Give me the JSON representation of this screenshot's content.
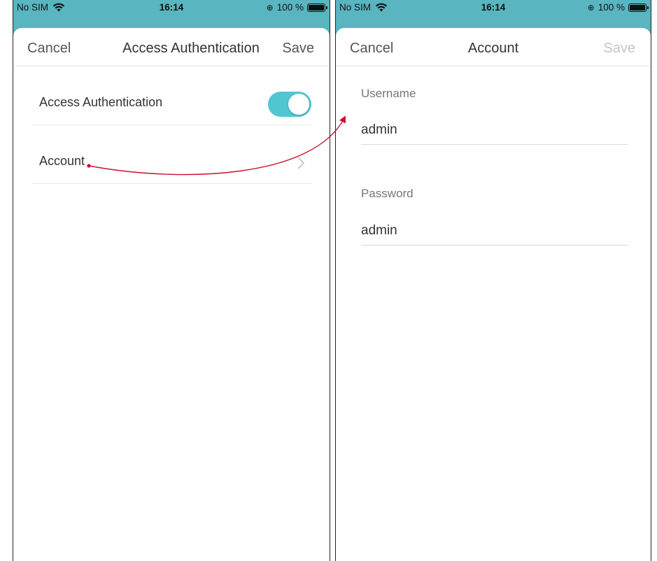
{
  "left_screen": {
    "status_bar": {
      "carrier": "No SIM",
      "time": "16:14",
      "battery": "100 %"
    },
    "nav": {
      "cancel": "Cancel",
      "title": "Access Authentication",
      "save": "Save"
    },
    "rows": [
      {
        "label": "Access Authentication",
        "control": "toggle",
        "toggle_on": true
      },
      {
        "label": "Account",
        "control": "chevron"
      }
    ]
  },
  "right_screen": {
    "status_bar": {
      "carrier": "No SIM",
      "time": "16:14",
      "battery": "100 %"
    },
    "nav": {
      "cancel": "Cancel",
      "title": "Account",
      "save": "Save"
    },
    "fields": [
      {
        "label": "Username",
        "value": "admin"
      },
      {
        "label": "Password",
        "value": "admin"
      }
    ]
  },
  "colors": {
    "status_bar_bg": "#59b5bf",
    "toggle_on": "#50c6d0",
    "annotation_arrow": "#c8102e"
  },
  "icons": [
    "wifi-icon",
    "rotation-lock-icon",
    "battery-icon",
    "chevron-right-icon"
  ]
}
